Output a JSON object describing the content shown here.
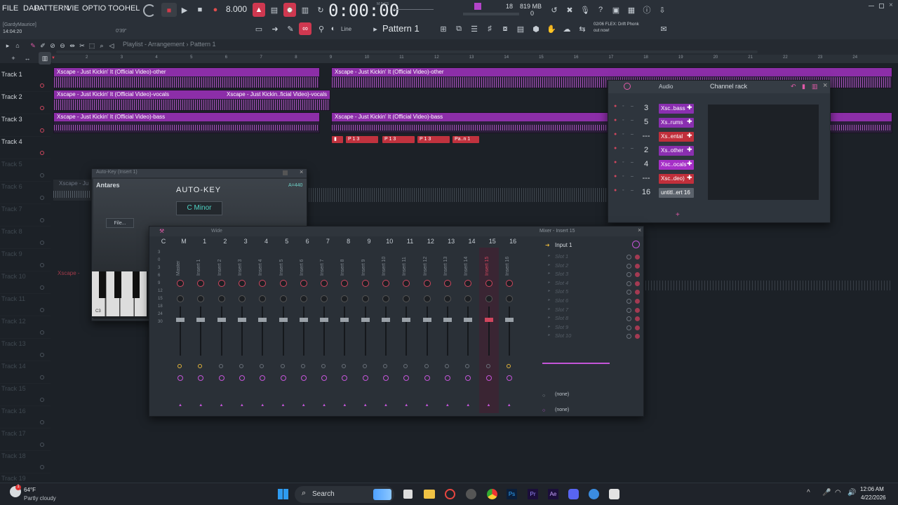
{
  "menu": [
    "FILE",
    "DAD",
    "PATTERN",
    "VIE",
    "OPTIO",
    "TOO",
    "HEL"
  ],
  "transport": {
    "tempo": "8.000",
    "time": "0:00:00",
    "time_sub": "M:S:CS",
    "cpu_num": "18",
    "mem": "819 MB",
    "mem_sub": "0"
  },
  "user": {
    "name": "[GardyMaurice]",
    "time": "14:04:20",
    "secs": "0'39\""
  },
  "pattern": {
    "name": "Pattern 1",
    "snap": "Line"
  },
  "news": {
    "line1": "02/06  FLEX: Drift Phonk",
    "line2": "out now!"
  },
  "playlist": {
    "breadcrumb": "Playlist - Arrangement  ›  Pattern 1",
    "ruler": [
      "2",
      "3",
      "4",
      "5",
      "6",
      "7",
      "8",
      "9",
      "10",
      "11",
      "12",
      "13",
      "14",
      "15",
      "16",
      "17",
      "18",
      "19",
      "20",
      "21",
      "22",
      "23",
      "24"
    ]
  },
  "tracks": [
    "Track 1",
    "Track 2",
    "Track 3",
    "Track 4",
    "Track 5",
    "Track 6",
    "Track 7",
    "Track 8",
    "Track 9",
    "Track 10",
    "Track 11",
    "Track 12",
    "Track 13",
    "Track 14",
    "Track 15",
    "Track 16",
    "Track 17",
    "Track 18",
    "Track 19"
  ],
  "clips": {
    "t1a": "Xscape - Just Kickin' It (Official Video)-other",
    "t1b": "Xscape - Just Kickin' It (Official Video)-other",
    "t2a": "Xscape - Just Kickin' It (Official Video)-vocals",
    "t2b": "Xscape - Just Kickin..ficial Video)-vocals",
    "t3a": "Xscape - Just Kickin' It (Official Video)-bass",
    "t3b": "Xscape - Just Kickin' It (Official Video)-bass",
    "r1": "P 1 3",
    "r2": "P 1 3",
    "r3": "P 1 3",
    "r4": "P 1 3",
    "r5": "Pa..n 1",
    "t6": "Xscape - Ju",
    "t10": "Xscape -"
  },
  "autokey": {
    "title": "Auto-Key (Insert 1)",
    "brand": "Antares",
    "name": "AUTO-KEY",
    "freq": "A=440",
    "key": "C Minor",
    "file_btn": "File...",
    "note": "C3"
  },
  "channel_rack": {
    "title": "Channel rack",
    "filter": "Audio",
    "channels": [
      {
        "num": "3",
        "name": "Xsc..bass",
        "color": "#8a2fb0"
      },
      {
        "num": "5",
        "name": "Xs..rums",
        "color": "#8a2fb0"
      },
      {
        "num": "---",
        "name": "Xs..ental",
        "color": "#c12f3b"
      },
      {
        "num": "2",
        "name": "Xs..other",
        "color": "#8a2fb0"
      },
      {
        "num": "4",
        "name": "Xsc..ocals",
        "color": "#a62fc7"
      },
      {
        "num": "---",
        "name": "Xsc..deo)",
        "color": "#c12f3b"
      },
      {
        "num": "16",
        "name": "untitl..ert 16",
        "color": "#5b626b"
      }
    ],
    "add": "+"
  },
  "mixer": {
    "title": "Mixer - Insert 15",
    "view": "Wide",
    "headers": [
      "C",
      "M",
      "1",
      "2",
      "3",
      "4",
      "5",
      "6",
      "7",
      "8",
      "9",
      "10",
      "11",
      "12",
      "13",
      "14",
      "15",
      "16"
    ],
    "strips": [
      "Master",
      "Insert 1",
      "Insert 2",
      "Insert 3",
      "Insert 4",
      "Insert 5",
      "Insert 6",
      "Insert 7",
      "Insert 8",
      "Insert 9",
      "Insert 10",
      "Insert 11",
      "Insert 12",
      "Insert 13",
      "Insert 14",
      "Insert 15",
      "Insert 16"
    ],
    "db": [
      "3",
      "0",
      "3",
      "6",
      "9",
      "12",
      "15",
      "18",
      "24",
      "30"
    ],
    "input": "Input 1",
    "slots": [
      "Slot 1",
      "Slot 2",
      "Slot 3",
      "Slot 4",
      "Slot 5",
      "Slot 6",
      "Slot 7",
      "Slot 8",
      "Slot 9",
      "Slot 10"
    ],
    "out1": "(none)",
    "out2": "(none)"
  },
  "taskbar": {
    "temp": "64°F",
    "weather": "Partly cloudy",
    "search": "Search",
    "time": "12:06 AM",
    "date": "4/22/2026"
  }
}
